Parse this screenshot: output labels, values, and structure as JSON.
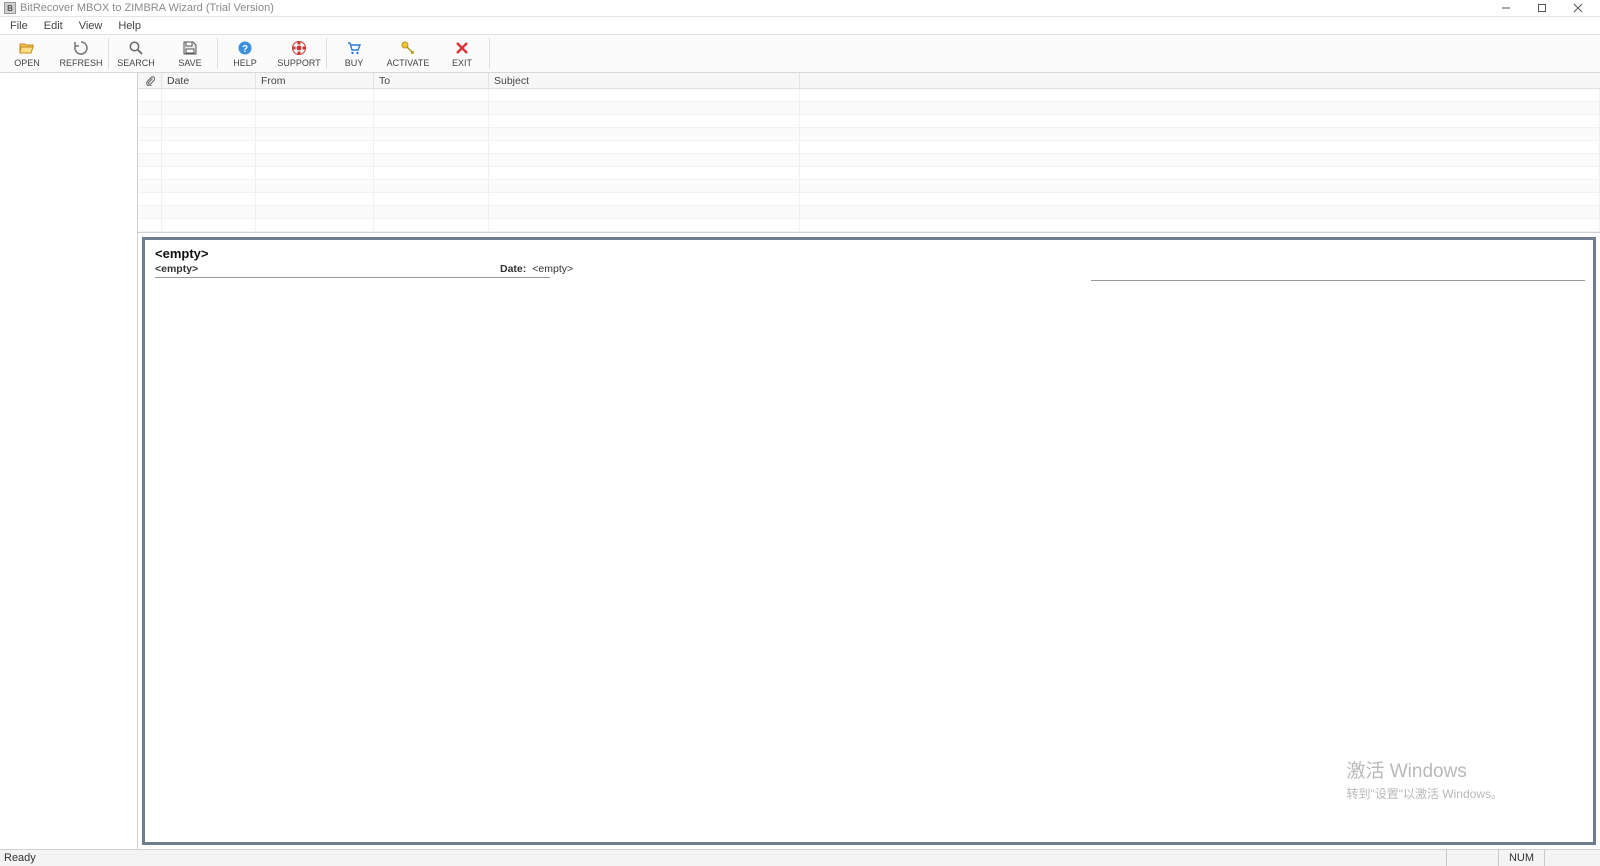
{
  "titlebar": {
    "app_icon_letter": "B",
    "title": "BitRecover MBOX to ZIMBRA Wizard (Trial Version)"
  },
  "menu": {
    "file": "File",
    "edit": "Edit",
    "view": "View",
    "help": "Help"
  },
  "toolbar": {
    "open": "OPEN",
    "refresh": "REFRESH",
    "search": "SEARCH",
    "save": "SAVE",
    "help": "HELP",
    "support": "SUPPORT",
    "buy": "BUY",
    "activate": "ACTIVATE",
    "exit": "EXIT"
  },
  "grid": {
    "cols": {
      "date": "Date",
      "from": "From",
      "to": "To",
      "subject": "Subject"
    }
  },
  "preview": {
    "subject": "<empty>",
    "from": "<empty>",
    "date_label": "Date:",
    "date_value": "<empty>"
  },
  "watermark": {
    "line1": "激活 Windows",
    "line2": "转到\"设置\"以激活 Windows。"
  },
  "status": {
    "ready": "Ready",
    "num": "NUM"
  }
}
